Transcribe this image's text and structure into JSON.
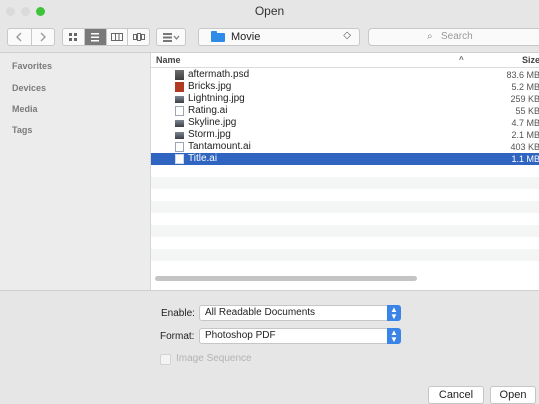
{
  "window": {
    "title": "Open",
    "traffic_lights": [
      {
        "name": "close",
        "color": "#dadada"
      },
      {
        "name": "minimize",
        "color": "#dadada"
      },
      {
        "name": "zoom",
        "color": "#3ec43b"
      }
    ]
  },
  "toolbar": {
    "back_icon": "chevron-left-icon",
    "forward_icon": "chevron-right-icon",
    "view_modes": [
      "icon-view",
      "list-view",
      "column-view",
      "cover-flow-view"
    ],
    "active_view": "list-view",
    "arrange_icon": "arrange-icon",
    "location": "Movie",
    "search_placeholder": "Search"
  },
  "sidebar": {
    "sections": [
      {
        "label": "Favorites"
      },
      {
        "label": "Devices"
      },
      {
        "label": "Media"
      },
      {
        "label": "Tags"
      }
    ]
  },
  "file_list": {
    "columns": {
      "name": "Name",
      "size": "Size"
    },
    "files": [
      {
        "name": "aftermath.psd",
        "size": "83.6 MB",
        "icon": "psd-file-icon",
        "selected": false
      },
      {
        "name": "Bricks.jpg",
        "size": "5.2 MB",
        "icon": "jpg-file-icon",
        "selected": false
      },
      {
        "name": "Lightning.jpg",
        "size": "259 KB",
        "icon": "jpg-file-icon",
        "selected": false
      },
      {
        "name": "Rating.ai",
        "size": "55 KB",
        "icon": "ai-file-icon",
        "selected": false
      },
      {
        "name": "Skyline.jpg",
        "size": "4.7 MB",
        "icon": "jpg-file-icon",
        "selected": false
      },
      {
        "name": "Storm.jpg",
        "size": "2.1 MB",
        "icon": "jpg-file-icon",
        "selected": false
      },
      {
        "name": "Tantamount.ai",
        "size": "403 KB",
        "icon": "ai-file-icon",
        "selected": false
      },
      {
        "name": "Title.ai",
        "size": "1.1 MB",
        "icon": "ai-file-icon",
        "selected": true
      }
    ]
  },
  "options": {
    "enable_label": "Enable:",
    "enable_value": "All Readable Documents",
    "format_label": "Format:",
    "format_value": "Photoshop PDF",
    "image_sequence_label": "Image Sequence",
    "image_sequence_enabled": false
  },
  "buttons": {
    "cancel": "Cancel",
    "open": "Open"
  },
  "colors": {
    "selection": "#2f64c1",
    "accent": "#3a84e8",
    "folder": "#2f8be8"
  }
}
